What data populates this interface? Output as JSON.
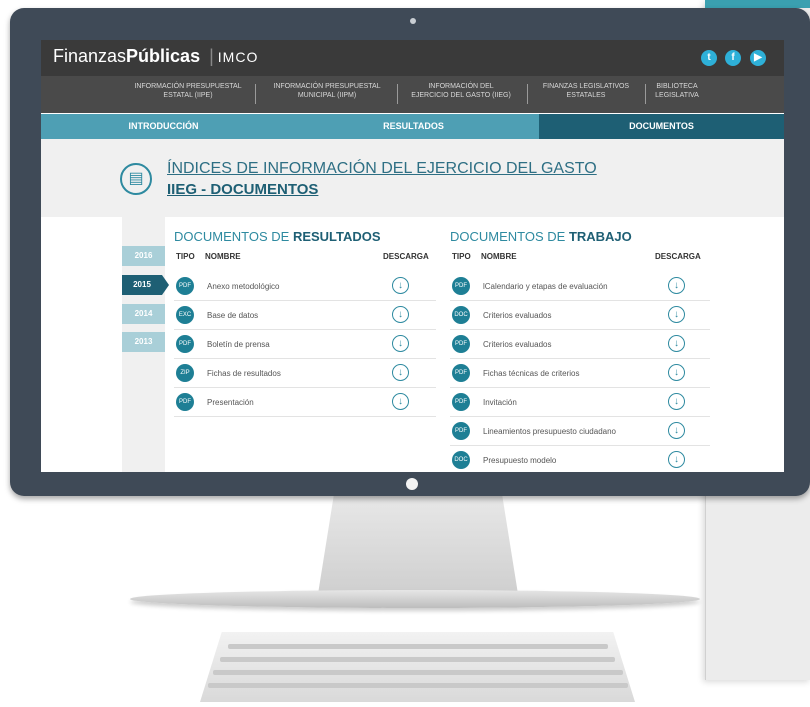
{
  "header": {
    "logo_part1": "Finanzas",
    "logo_part2": "Públicas",
    "logo_org": "IMCO",
    "social": [
      {
        "icon": "twitter-icon",
        "glyph": "t"
      },
      {
        "icon": "facebook-icon",
        "glyph": "f"
      },
      {
        "icon": "youtube-icon",
        "glyph": "▶"
      }
    ]
  },
  "nav": {
    "items": [
      {
        "label_line1": "INFORMACIÓN PRESUPUESTAL",
        "label_line2": "ESTATAL (IIPE)"
      },
      {
        "label_line1": "INFORMACIÓN PRESUPUESTAL",
        "label_line2": "MUNICIPAL (IIPM)"
      },
      {
        "label_line1": "INFORMACIÓN DEL",
        "label_line2": "EJERCICIO DEL GASTO (IIEG)"
      },
      {
        "label_line1": "FINANZAS LEGISLATIVOS",
        "label_line2": "ESTATALES"
      },
      {
        "label_line1": "BIBLIOTECA",
        "label_line2": "LEGISLATIVA"
      }
    ]
  },
  "tabs": [
    {
      "label": "INTRODUCCIÓN"
    },
    {
      "label": "RESULTADOS"
    },
    {
      "label": "DOCUMENTOS",
      "active": true
    }
  ],
  "page": {
    "title": "ÍNDICES DE INFORMACIÓN DEL EJERCICIO DEL GASTO",
    "subtitle": "IIEG - DOCUMENTOS"
  },
  "years": [
    {
      "label": "2016"
    },
    {
      "label": "2015",
      "active": true
    },
    {
      "label": "2014"
    },
    {
      "label": "2013"
    }
  ],
  "resultados": {
    "heading_prefix": "DOCUMENTOS DE ",
    "heading_bold": "RESULTADOS",
    "col_tipo": "TIPO",
    "col_nombre": "NOMBRE",
    "col_descarga": "DESCARGA",
    "rows": [
      {
        "tipo": "PDF",
        "nombre": "Anexo metodológico"
      },
      {
        "tipo": "EXC",
        "nombre": "Base de datos"
      },
      {
        "tipo": "PDF",
        "nombre": "Boletín de prensa"
      },
      {
        "tipo": "ZIP",
        "nombre": "Fichas de resultados"
      },
      {
        "tipo": "PDF",
        "nombre": "Presentación"
      }
    ]
  },
  "trabajo": {
    "heading_prefix": "DOCUMENTOS DE ",
    "heading_bold": "TRABAJO",
    "col_tipo": "TIPO",
    "col_nombre": "NOMBRE",
    "col_descarga": "DESCARGA",
    "rows": [
      {
        "tipo": "PDF",
        "nombre": "lCalendario y etapas de evaluación"
      },
      {
        "tipo": "DOC",
        "nombre": "Criterios evaluados"
      },
      {
        "tipo": "PDF",
        "nombre": "Criterios evaluados"
      },
      {
        "tipo": "PDF",
        "nombre": "Fichas técnicas de criterios"
      },
      {
        "tipo": "PDF",
        "nombre": "Invitación"
      },
      {
        "tipo": "PDF",
        "nombre": "Lineamientos presupuesto ciudadano"
      },
      {
        "tipo": "DOC",
        "nombre": "Presupuesto modelo"
      }
    ]
  },
  "icons": {
    "download": "download-icon",
    "document": "document-icon"
  },
  "colors": {
    "accent": "#2e8aa0",
    "dark_teal": "#1e5f74",
    "tab_bar": "#4e9fb4",
    "header": "#3a3a3a"
  }
}
